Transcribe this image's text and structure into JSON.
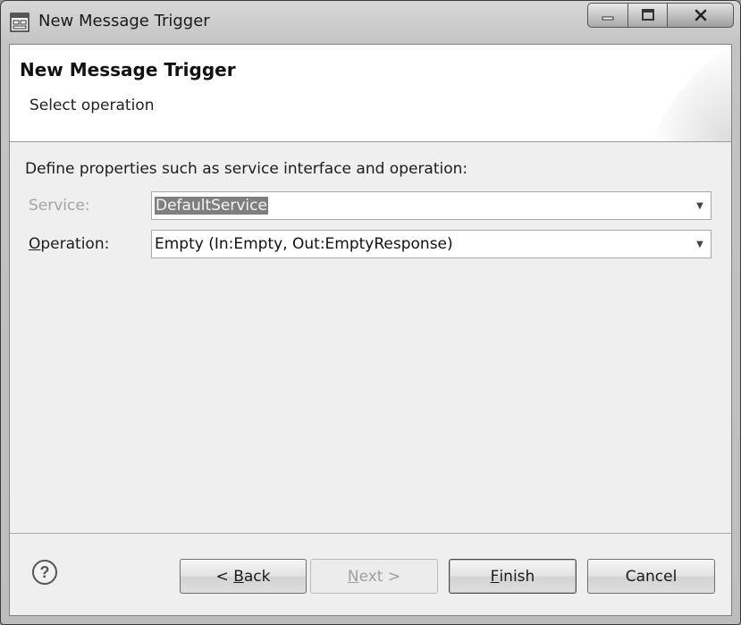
{
  "window": {
    "title": "New Message Trigger"
  },
  "banner": {
    "title": "New Message Trigger",
    "subtitle": "Select operation"
  },
  "form": {
    "description": "Define properties such as service interface and operation:",
    "service": {
      "label": "Service:",
      "value": "DefaultService",
      "enabled": false
    },
    "operation": {
      "label_mnemonic": "O",
      "label_rest": "peration:",
      "value": "Empty (In:Empty, Out:EmptyResponse)",
      "enabled": true
    }
  },
  "buttons": {
    "back": {
      "prefix": "< ",
      "mnemonic": "B",
      "rest": "ack",
      "enabled": true
    },
    "next": {
      "mnemonic": "N",
      "rest": "ext >",
      "enabled": false
    },
    "finish": {
      "mnemonic": "F",
      "rest": "inish",
      "enabled": true,
      "default": true
    },
    "cancel": {
      "label": "Cancel",
      "enabled": true
    }
  },
  "icons": {
    "app": "wizard-window-icon",
    "help": "help-icon",
    "dropdown": "chevron-down-icon"
  }
}
